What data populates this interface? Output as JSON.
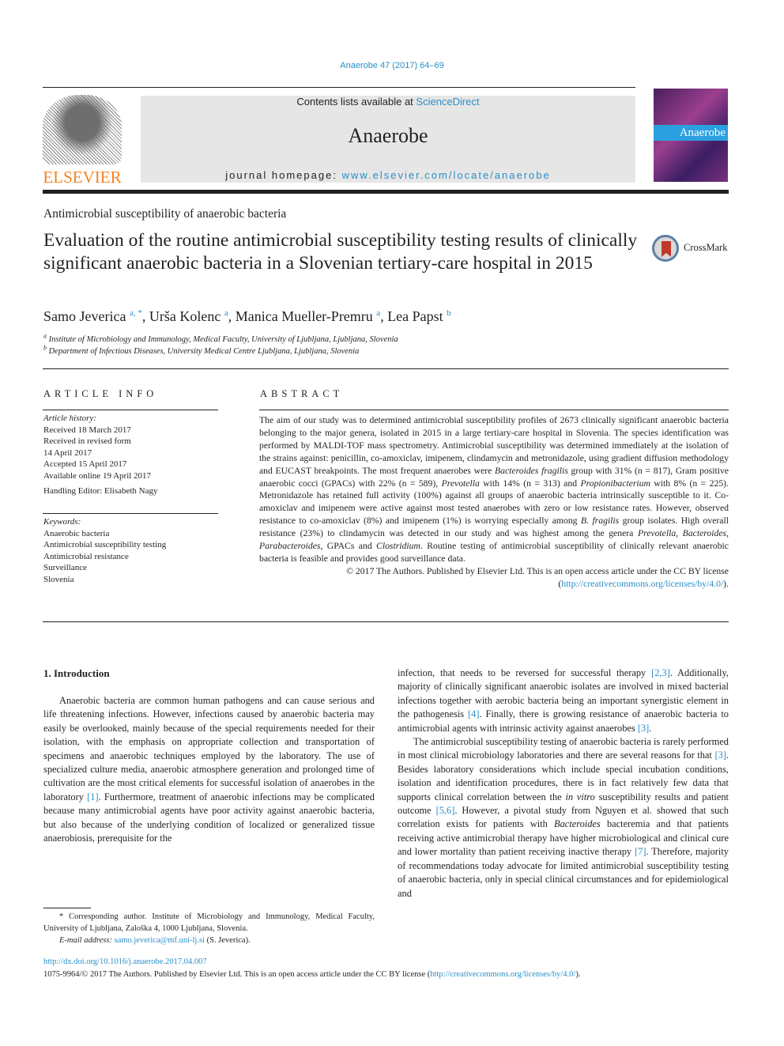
{
  "header": {
    "citation": "Anaerobe 47 (2017) 64–69",
    "publisher_logo_text": "ELSEVIER",
    "contents_prefix": "Contents lists available at ",
    "contents_link": "ScienceDirect",
    "journal_title": "Anaerobe",
    "homepage_prefix": "journal homepage: ",
    "homepage_link": "www.elsevier.com/locate/anaerobe",
    "cover_title": "Anaerobe",
    "crossmark_label": "CrossMark"
  },
  "article": {
    "section": "Antimicrobial susceptibility of anaerobic bacteria",
    "title": "Evaluation of the routine antimicrobial susceptibility testing results of clinically significant anaerobic bacteria in a Slovenian tertiary-care hospital in 2015",
    "authors": [
      {
        "name": "Samo Jeverica",
        "sup": "a, *"
      },
      {
        "name": "Urša Kolenc",
        "sup": "a"
      },
      {
        "name": "Manica Mueller-Premru",
        "sup": "a"
      },
      {
        "name": "Lea Papst",
        "sup": "b"
      }
    ],
    "affiliations": [
      {
        "key": "a",
        "text": "Institute of Microbiology and Immunology, Medical Faculty, University of Ljubljana, Ljubljana, Slovenia"
      },
      {
        "key": "b",
        "text": "Department of Infectious Diseases, University Medical Centre Ljubljana, Ljubljana, Slovenia"
      }
    ]
  },
  "article_info": {
    "heading": "ARTICLE INFO",
    "history_label": "Article history:",
    "history": [
      "Received 18 March 2017",
      "Received in revised form",
      "14 April 2017",
      "Accepted 15 April 2017",
      "Available online 19 April 2017"
    ],
    "handling_editor": "Handling Editor: Elisabeth Nagy",
    "keywords_label": "Keywords:",
    "keywords": [
      "Anaerobic bacteria",
      "Antimicrobial susceptibility testing",
      "Antimicrobial resistance",
      "Surveillance",
      "Slovenia"
    ]
  },
  "abstract": {
    "heading": "ABSTRACT",
    "p1": "The aim of our study was to determined antimicrobial susceptibility profiles of 2673 clinically significant anaerobic bacteria belonging to the major genera, isolated in 2015 in a large tertiary-care hospital in Slovenia. The species identification was performed by MALDI-TOF mass spectrometry. Antimicrobial susceptibility was determined immediately at the isolation of the strains against: penicillin, co-amoxiclav, imipenem, clindamycin and metronidazole, using gradient diffusion methodology and EUCAST breakpoints. The most frequent anaerobes were ",
    "i1": "Bacteroides fragilis",
    "p2": " group with 31% (n = 817), Gram positive anaerobic cocci (GPACs) with 22% (n = 589), ",
    "i2": "Prevotella",
    "p3": " with 14% (n = 313) and ",
    "i3": "Propionibacterium",
    "p4": " with 8% (n = 225). Metronidazole has retained full activity (100%) against all groups of anaerobic bacteria intrinsically susceptible to it. Co-amoxiclav and imipenem were active against most tested anaerobes with zero or low resistance rates. However, observed resistance to co-amoxiclav (8%) and imipenem (1%) is worrying especially among ",
    "i4": "B. fragilis",
    "p5": " group isolates. High overall resistance (23%) to clindamycin was detected in our study and was highest among the genera ",
    "i5": "Prevotella, Bacteroides, Parabacteroides",
    "p6": ", GPACs and ",
    "i6": "Clostridium",
    "p7": ". Routine testing of antimicrobial susceptibility of clinically relevant anaerobic bacteria is feasible and provides good surveillance data.",
    "copyright": "© 2017 The Authors. Published by Elsevier Ltd. This is an open access article under the CC BY license",
    "license_link": "http://creativecommons.org/licenses/by/4.0/"
  },
  "intro": {
    "heading": "1.  Introduction",
    "left_p1": "Anaerobic bacteria are common human pathogens and can cause serious and life threatening infections. However, infections caused by anaerobic bacteria may easily be overlooked, mainly because of the special requirements needed for their isolation, with the emphasis on appropriate collection and transportation of specimens and anaerobic techniques employed by the laboratory. The use of specialized culture media, anaerobic atmosphere generation and prolonged time of cultivation are the most critical elements for successful isolation of anaerobes in the laboratory ",
    "ref1": "[1]",
    "left_p1b": ". Furthermore, treatment of anaerobic infections may be complicated because many antimicrobial agents have poor activity against anaerobic bacteria, but also because of the underlying condition of localized or generalized tissue anaerobiosis, prerequisite for the",
    "right_a": "infection, that needs to be reversed for successful therapy ",
    "ref23": "[2,3]",
    "right_b": ". Additionally, majority of clinically significant anaerobic isolates are involved in mixed bacterial infections together with aerobic bacteria being an important synergistic element in the pathogenesis ",
    "ref4": "[4]",
    "right_c": ". Finally, there is growing resistance of anaerobic bacteria to antimicrobial agents with intrinsic activity against anaerobes ",
    "ref3": "[3]",
    "right_d": ".",
    "right_p2a": "The antimicrobial susceptibility testing of anaerobic bacteria is rarely performed in most clinical microbiology laboratories and there are several reasons for that ",
    "ref3b": "[3]",
    "right_p2b": ". Besides laboratory considerations which include special incubation conditions, isolation and identification procedures, there is in fact relatively few data that supports clinical correlation between the ",
    "invitro": "in vitro",
    "right_p2c": " susceptibility results and patient outcome ",
    "ref56": "[5,6]",
    "right_p2d": ". However, a pivotal study from Nguyen et al. showed that such correlation exists for patients with ",
    "bacteroides": "Bacteroides",
    "right_p2e": " bacteremia and that patients receiving active antimicrobial therapy have higher microbiological and clinical cure and lower mortality than patient receiving inactive therapy ",
    "ref7": "[7]",
    "right_p2f": ". Therefore, majority of recommendations today advocate for limited antimicrobial susceptibility testing of anaerobic bacteria, only in special clinical circumstances and for epidemiological and"
  },
  "footnote": {
    "corresponding": "* Corresponding author. Institute of Microbiology and Immunology, Medical Faculty, University of Ljubljana, Zaloška 4, 1000 Ljubljana, Slovenia.",
    "email_label": "E-mail address: ",
    "email": "samo.jeverica@mf.uni-lj.si",
    "email_suffix": " (S. Jeverica)."
  },
  "footer": {
    "doi": "http://dx.doi.org/10.1016/j.anaerobe.2017.04.007",
    "license_prefix": "1075-9964/© 2017 The Authors. Published by Elsevier Ltd. This is an open access article under the CC BY license (",
    "license_link": "http://creativecommons.org/licenses/by/4.0/",
    "license_suffix": ")."
  }
}
